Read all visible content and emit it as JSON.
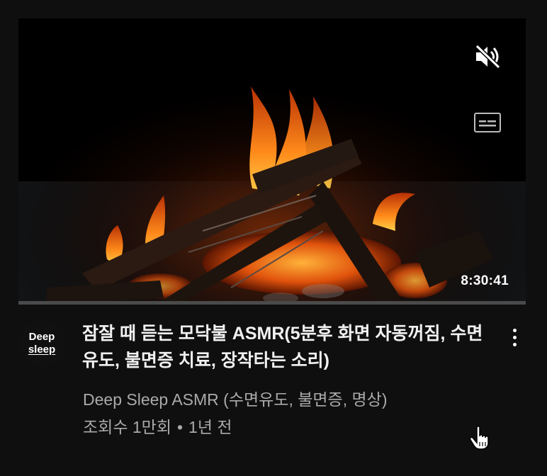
{
  "video": {
    "duration": "8:30:41",
    "title": "잠잘 때 듣는 모닥불 ASMR(5분후 화면 자동꺼짐, 수면유도, 불면증 치료, 장작타는 소리)",
    "channel": "Deep Sleep ASMR (수면유도, 불면증, 명상)",
    "views": "조회수 1만회",
    "separator": "•",
    "age": "1년 전"
  },
  "avatar": {
    "line1": "Deep",
    "line2": "sleep"
  },
  "icons": {
    "mute": "volume-muted-icon",
    "captions": "captions-icon",
    "more": "more-vert-icon",
    "cursor": "hand-pointer-icon"
  },
  "colors": {
    "background": "#0f0f0f",
    "secondary_text": "#aaaaaa",
    "flame": "#ff8a1a"
  }
}
